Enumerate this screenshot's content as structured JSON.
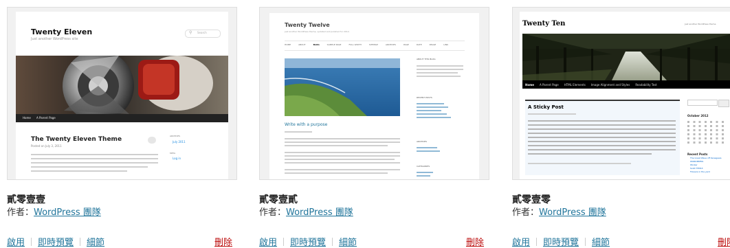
{
  "themes": [
    {
      "name": "貳零壹壹",
      "author_prefix": "作者：",
      "author": "WordPress 團隊",
      "actions": {
        "activate": "啟用",
        "preview": "即時預覽",
        "details": "細節",
        "delete": "刪除"
      },
      "screenshot": {
        "site_title": "Twenty Eleven",
        "tagline": "Just another WordPress site",
        "search_placeholder": "Search",
        "nav": [
          "Home",
          "A Parent Page"
        ],
        "post_title": "The Twenty Eleven Theme",
        "post_meta": "Posted on July 3, 2011",
        "sidebar_headings": [
          "ARCHIVES",
          "META"
        ],
        "sidebar_links": [
          "July 2011",
          "Log in"
        ]
      }
    },
    {
      "name": "貳零壹貳",
      "author_prefix": "作者：",
      "author": "WordPress 團隊",
      "actions": {
        "activate": "啟用",
        "preview": "即時預覽",
        "details": "細節",
        "delete": "刪除"
      },
      "screenshot": {
        "site_title": "Twenty Twelve",
        "tagline": "Just another WordPress theme, updated and polished for 2012.",
        "nav": [
          "HOME",
          "ABOUT",
          "BLOG",
          "SAMPLE PAGE",
          "FULL WIDTH",
          "SITEMAP",
          "ARCHIVES",
          "PAGE",
          "DATE",
          "IMAGE",
          "LINK"
        ],
        "post_title": "Write with a purpose",
        "sidebar_headings": [
          "ABOUT THIS BLOG",
          "RECENT POSTS",
          "ARCHIVES",
          "CATEGORIES"
        ]
      }
    },
    {
      "name": "貳零壹零",
      "author_prefix": "作者：",
      "author": "WordPress 團隊",
      "actions": {
        "activate": "啟用",
        "preview": "即時預覽",
        "details": "細節",
        "delete": "刪除"
      },
      "screenshot": {
        "site_title": "Twenty Ten",
        "tagline": "Just another WordPress theme",
        "nav": [
          "Home",
          "A Parent Page",
          "HTML Elements",
          "Image Alignment and Styles",
          "Readability Test"
        ],
        "post_title": "A Sticky Post",
        "calendar_title": "October 2012",
        "sidebar_headings": [
          "Recent Posts"
        ],
        "sidebar_links": [
          "The Great Wave off Kanagawa",
          "WORDPRESS",
          "Worker",
          "Solid HTML5",
          "Flowers in the yard"
        ]
      }
    }
  ]
}
